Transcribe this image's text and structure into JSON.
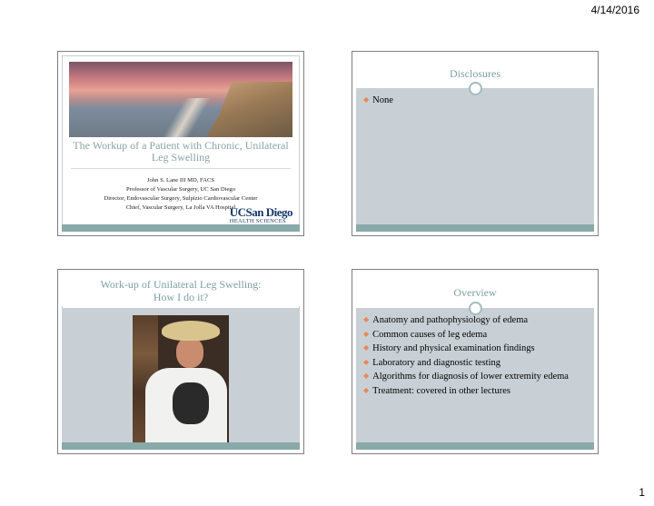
{
  "page": {
    "date": "4/14/2016",
    "number": "1"
  },
  "slide1": {
    "title": "The Workup of a Patient with Chronic, Unilateral Leg Swelling",
    "credits": [
      "John S. Lane III MD, FACS",
      "Professor of Vascular Surgery, UC San Diego",
      "Director, Endovascular Surgery, Sulpizio Cardiovascular Center",
      "Chief, Vascular Surgery, La Jolla VA Hospital"
    ],
    "logo_line1": "UCSan Diego",
    "logo_line2": "HEALTH SCIENCES"
  },
  "slide2": {
    "title": "Disclosures",
    "bullets": [
      "None"
    ]
  },
  "slide3": {
    "title_line1": "Work-up of Unilateral Leg Swelling:",
    "title_line2": "How I do it?"
  },
  "slide4": {
    "title": "Overview",
    "bullets": [
      "Anatomy and pathophysiology of edema",
      "Common causes of leg edema",
      "History and physical examination findings",
      "Laboratory and diagnostic testing",
      "Algorithms for diagnosis of lower extremity edema",
      "Treatment:  covered in other lectures"
    ]
  },
  "colors": {
    "accent": "#7c9fa4",
    "panel": "#c8d0d5",
    "bar": "#8aa9a9",
    "bullet": "#e8885a"
  },
  "icons": {
    "bullet": "bullet-diamond"
  }
}
